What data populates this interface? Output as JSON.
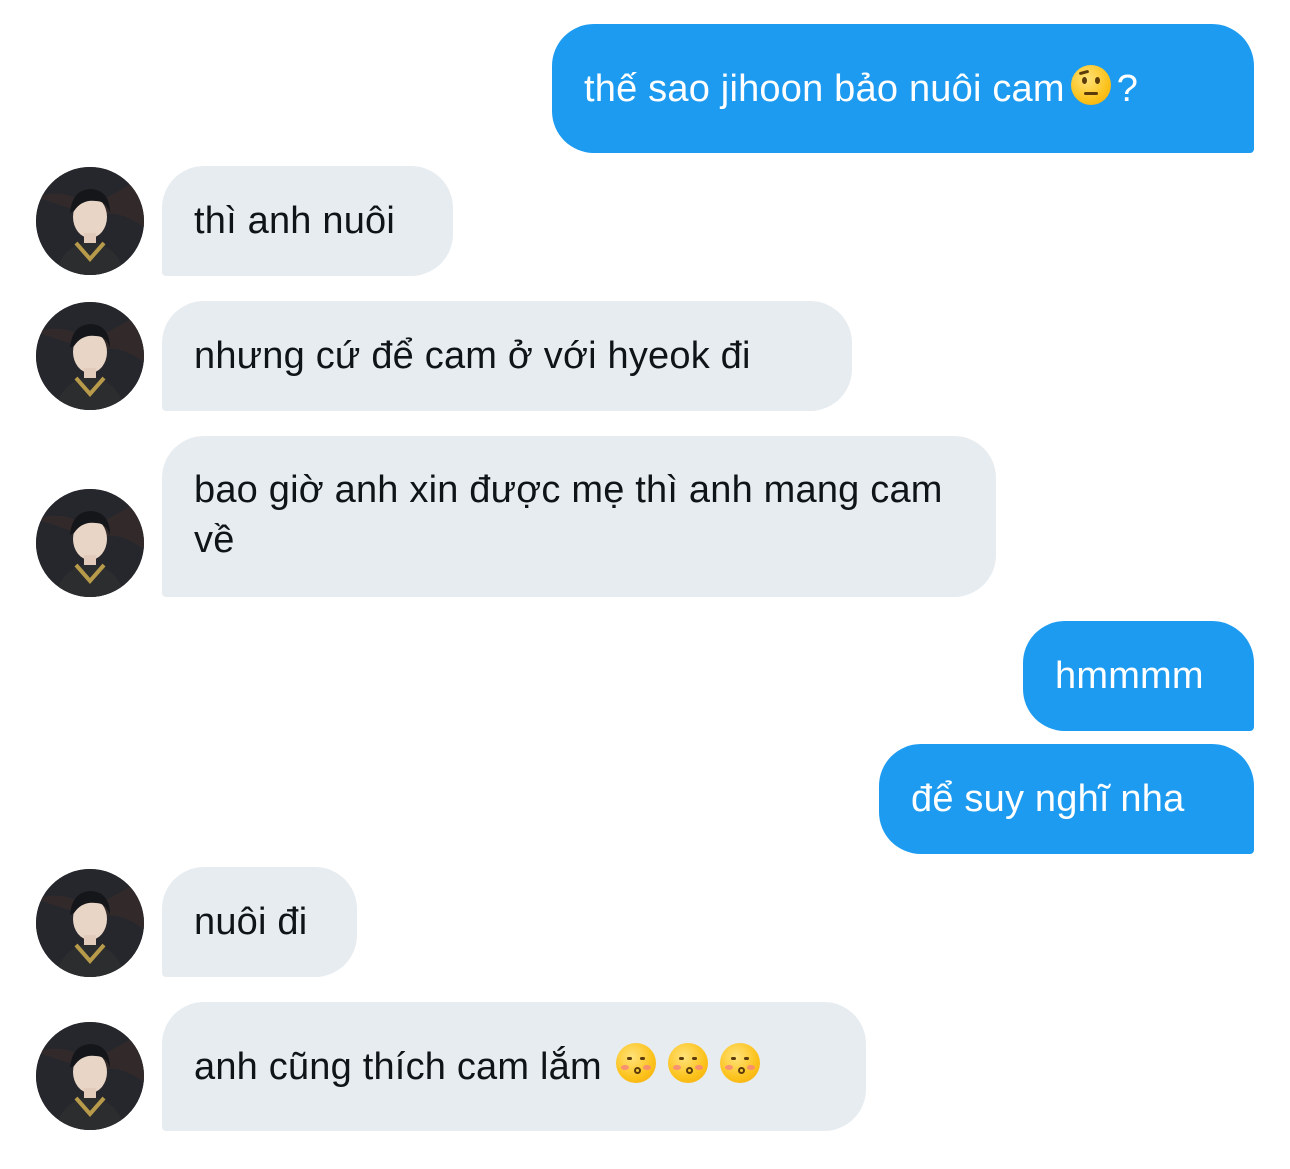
{
  "conversation": {
    "messages": [
      {
        "direction": "outgoing",
        "text": "thế sao jihoon bảo nuôi cam",
        "suffix_emoji": "face-with-raised-eyebrow",
        "suffix_text": "?"
      },
      {
        "direction": "incoming",
        "text": "thì anh nuôi"
      },
      {
        "direction": "incoming",
        "text": "nhưng cứ để cam ở với hyeok đi"
      },
      {
        "direction": "incoming",
        "text": "bao giờ anh xin được mẹ thì anh mang cam về"
      },
      {
        "direction": "outgoing",
        "text": "hmmmm"
      },
      {
        "direction": "outgoing",
        "text": "để suy nghĩ nha"
      },
      {
        "direction": "incoming",
        "text": "nuôi đi"
      },
      {
        "direction": "incoming",
        "text": "anh cũng thích cam lắm",
        "suffix_emoji": "kissing-face-with-smiling-eyes",
        "suffix_count": 3
      }
    ]
  },
  "colors": {
    "outgoing_bubble": "#1d9bf0",
    "incoming_bubble": "#e7ecf0",
    "outgoing_text": "#ffffff",
    "incoming_text": "#0f1419"
  }
}
